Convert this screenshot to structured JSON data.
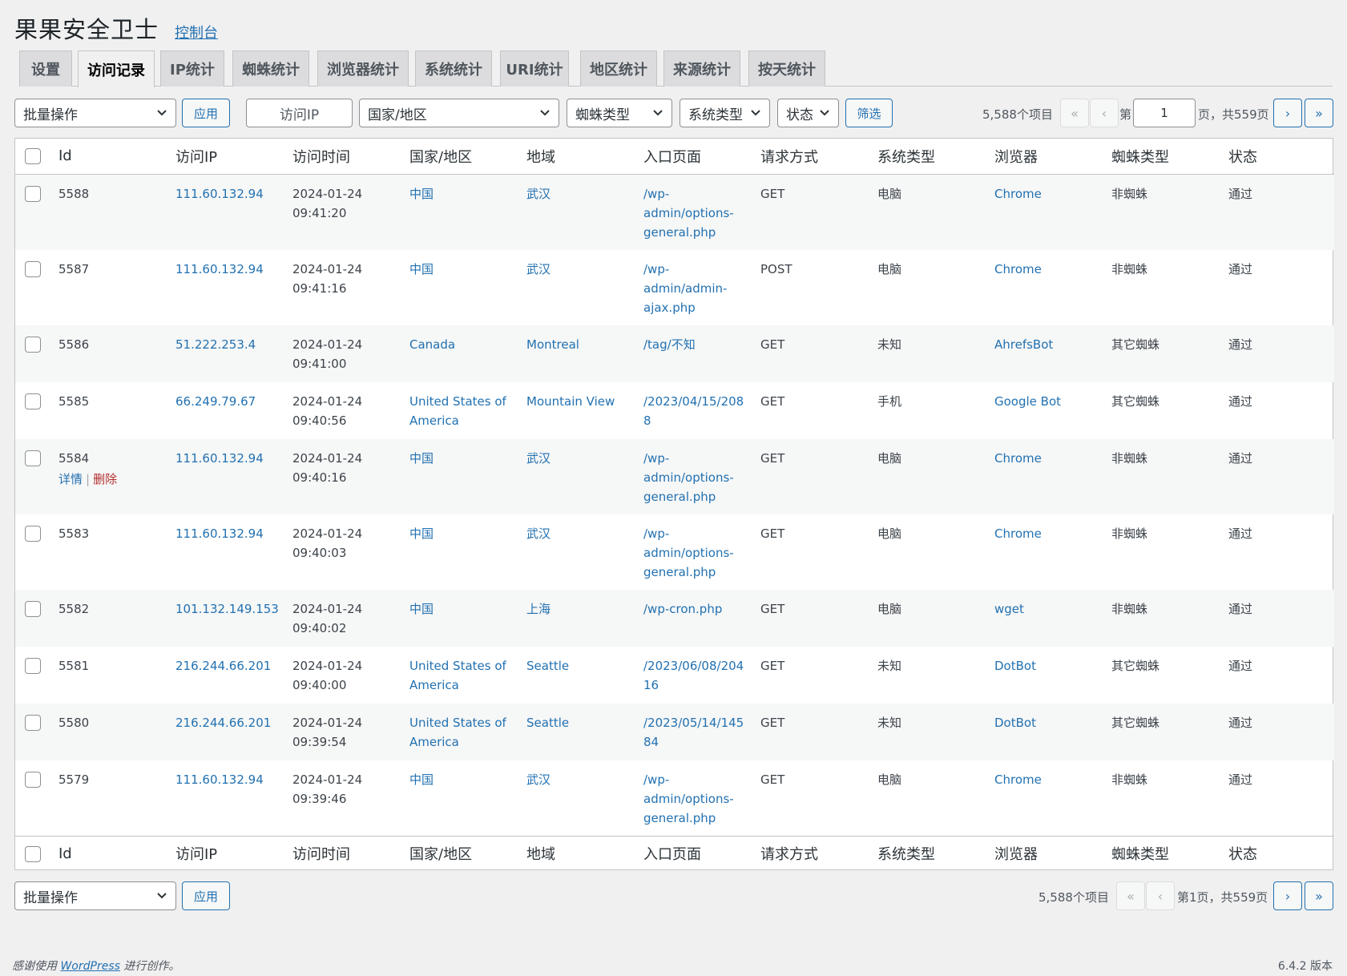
{
  "header": {
    "title": "果果安全卫士",
    "dashboard_link": "控制台"
  },
  "tabs": [
    {
      "label": "设置"
    },
    {
      "label": "访问记录"
    },
    {
      "label": "IP统计"
    },
    {
      "label": "蜘蛛统计"
    },
    {
      "label": "浏览器统计"
    },
    {
      "label": "系统统计"
    },
    {
      "label": "URI统计"
    },
    {
      "label": "地区统计"
    },
    {
      "label": "来源统计"
    },
    {
      "label": "按天统计"
    }
  ],
  "active_tab": "访问记录",
  "filters": {
    "bulk_action": "批量操作",
    "apply": "应用",
    "ip_placeholder": "访问IP",
    "country": "国家/地区",
    "spider_type": "蜘蛛类型",
    "system_type": "系统类型",
    "status": "状态",
    "filter_button": "筛选"
  },
  "pagination_top": {
    "items": "5,588个项目",
    "first": "«",
    "prev": "‹",
    "page_prefix": "第",
    "current_page": "1",
    "page_suffix": "页，共559页",
    "next": "›",
    "last": "»"
  },
  "table": {
    "columns": [
      "Id",
      "访问IP",
      "访问时间",
      "国家/地区",
      "地域",
      "入口页面",
      "请求方式",
      "系统类型",
      "浏览器",
      "蜘蛛类型",
      "状态"
    ],
    "rows": [
      {
        "id": "5588",
        "ip": "111.60.132.94",
        "time": "2024-01-24 09:41:20",
        "country": "中国",
        "region": "武汉",
        "page": "/wp-admin/options-general.php",
        "method": "GET",
        "system": "电脑",
        "browser": "Chrome",
        "spider": "非蜘蛛",
        "status": "通过"
      },
      {
        "id": "5587",
        "ip": "111.60.132.94",
        "time": "2024-01-24 09:41:16",
        "country": "中国",
        "region": "武汉",
        "page": "/wp-admin/admin-ajax.php",
        "method": "POST",
        "system": "电脑",
        "browser": "Chrome",
        "spider": "非蜘蛛",
        "status": "通过"
      },
      {
        "id": "5586",
        "ip": "51.222.253.4",
        "time": "2024-01-24 09:41:00",
        "country": "Canada",
        "region": "Montreal",
        "page": "/tag/不知",
        "method": "GET",
        "system": "未知",
        "browser": "AhrefsBot",
        "spider": "其它蜘蛛",
        "status": "通过"
      },
      {
        "id": "5585",
        "ip": "66.249.79.67",
        "time": "2024-01-24 09:40:56",
        "country": "United States of America",
        "region": "Mountain View",
        "page": "/2023/04/15/2088",
        "method": "GET",
        "system": "手机",
        "browser": "Google Bot",
        "spider": "其它蜘蛛",
        "status": "通过"
      },
      {
        "id": "5584",
        "ip": "111.60.132.94",
        "time": "2024-01-24 09:40:16",
        "country": "中国",
        "region": "武汉",
        "page": "/wp-admin/options-general.php",
        "method": "GET",
        "system": "电脑",
        "browser": "Chrome",
        "spider": "非蜘蛛",
        "status": "通过",
        "actions": {
          "details": "详情",
          "sep": "|",
          "delete": "删除"
        }
      },
      {
        "id": "5583",
        "ip": "111.60.132.94",
        "time": "2024-01-24 09:40:03",
        "country": "中国",
        "region": "武汉",
        "page": "/wp-admin/options-general.php",
        "method": "GET",
        "system": "电脑",
        "browser": "Chrome",
        "spider": "非蜘蛛",
        "status": "通过"
      },
      {
        "id": "5582",
        "ip": "101.132.149.153",
        "time": "2024-01-24 09:40:02",
        "country": "中国",
        "region": "上海",
        "page": "/wp-cron.php",
        "method": "GET",
        "system": "电脑",
        "browser": "wget",
        "spider": "非蜘蛛",
        "status": "通过"
      },
      {
        "id": "5581",
        "ip": "216.244.66.201",
        "time": "2024-01-24 09:40:00",
        "country": "United States of America",
        "region": "Seattle",
        "page": "/2023/06/08/20416",
        "method": "GET",
        "system": "未知",
        "browser": "DotBot",
        "spider": "其它蜘蛛",
        "status": "通过"
      },
      {
        "id": "5580",
        "ip": "216.244.66.201",
        "time": "2024-01-24 09:39:54",
        "country": "United States of America",
        "region": "Seattle",
        "page": "/2023/05/14/14584",
        "method": "GET",
        "system": "未知",
        "browser": "DotBot",
        "spider": "其它蜘蛛",
        "status": "通过"
      },
      {
        "id": "5579",
        "ip": "111.60.132.94",
        "time": "2024-01-24 09:39:46",
        "country": "中国",
        "region": "武汉",
        "page": "/wp-admin/options-general.php",
        "method": "GET",
        "system": "电脑",
        "browser": "Chrome",
        "spider": "非蜘蛛",
        "status": "通过"
      }
    ]
  },
  "bottom": {
    "bulk_action": "批量操作",
    "apply": "应用",
    "items": "5,588个项目",
    "first": "«",
    "prev": "‹",
    "page_info": "第1页，共559页",
    "next": "›",
    "last": "»"
  },
  "footer": {
    "thanks_prefix": "感谢使用",
    "wordpress": "WordPress",
    "thanks_suffix": "进行创作。",
    "version": "6.4.2 版本"
  }
}
